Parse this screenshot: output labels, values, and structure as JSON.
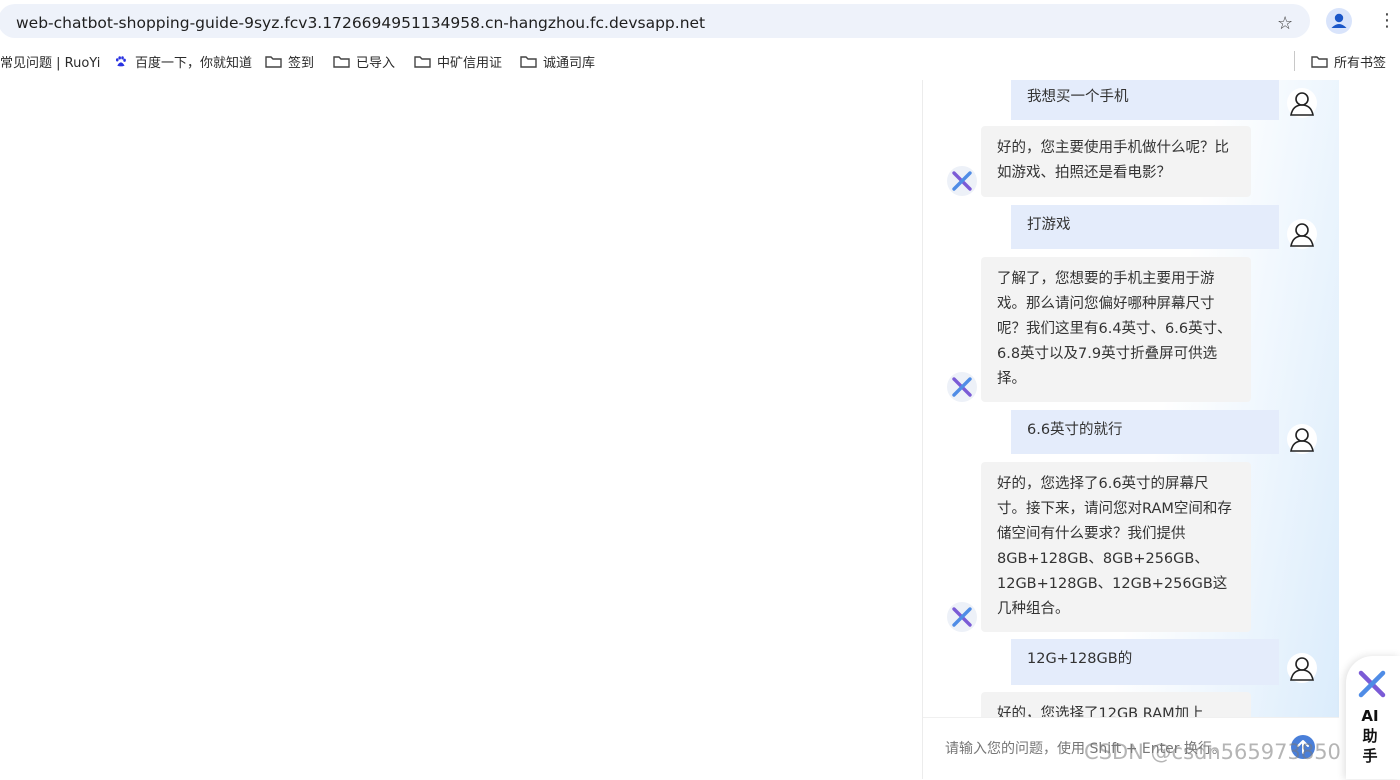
{
  "address_bar": {
    "url": "web-chatbot-shopping-guide-9syz.fcv3.1726694951134958.cn-hangzhou.fc.devsapp.net",
    "star_icon": "star-outline-icon",
    "profile_icon": "profile-avatar-icon",
    "menu_icon": "kebab-menu-icon"
  },
  "bookmarks": {
    "items": [
      {
        "label": "常见问题 | RuoYi",
        "icon": "site-icon"
      },
      {
        "label": "百度一下，你就知道",
        "icon": "baidu-paw-icon"
      },
      {
        "label": "签到",
        "icon": "folder-icon"
      },
      {
        "label": "已导入",
        "icon": "folder-icon"
      },
      {
        "label": "中矿信用证",
        "icon": "folder-icon"
      },
      {
        "label": "诚通司库",
        "icon": "folder-icon"
      }
    ],
    "all_bookmarks": "所有书签"
  },
  "chat": {
    "messages": [
      {
        "role": "user",
        "text": "我想买一个手机"
      },
      {
        "role": "bot",
        "text": "好的，您主要使用手机做什么呢？比如游戏、拍照还是看电影？"
      },
      {
        "role": "user",
        "text": "打游戏"
      },
      {
        "role": "bot",
        "text": "了解了，您想要的手机主要用于游戏。那么请问您偏好哪种屏幕尺寸呢？我们这里有6.4英寸、6.6英寸、6.8英寸以及7.9英寸折叠屏可供选择。"
      },
      {
        "role": "user",
        "text": "6.6英寸的就行"
      },
      {
        "role": "bot",
        "text": "好的，您选择了6.6英寸的屏幕尺寸。接下来，请问您对RAM空间和存储空间有什么要求？我们提供8GB+128GB、8GB+256GB、12GB+128GB、12GB+256GB这几种组合。"
      },
      {
        "role": "user",
        "text": "12G+128GB的"
      },
      {
        "role": "bot",
        "text": "好的，您选择了12GB RAM加上"
      }
    ],
    "input_placeholder": "请输入您的问题，使用 Shift + Enter 换行。",
    "send_icon": "send-icon"
  },
  "ai_helper": {
    "label": "AI助手",
    "icon": "ai-x-logo-icon"
  },
  "watermark": "CSDN @csdn565973850",
  "colors": {
    "user_bubble": "#e4ecfb",
    "bot_bubble": "#f3f3f3",
    "accent_blue": "#4a7fd9",
    "logo_blue": "#5b7fe0"
  }
}
